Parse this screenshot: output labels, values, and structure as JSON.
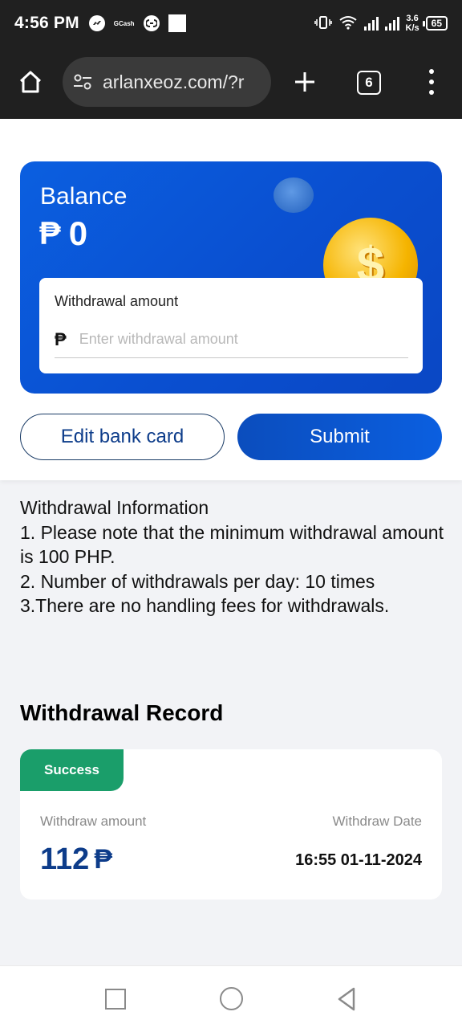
{
  "status_bar": {
    "time": "4:56 PM",
    "gcash_label": "GCash",
    "speed_top": "3.6",
    "speed_bottom": "K/s",
    "battery": "65"
  },
  "browser": {
    "url": "arlanxeoz.com/?r",
    "tab_count": "6"
  },
  "balance": {
    "label": "Balance",
    "currency_symbol": "₱",
    "amount": "0"
  },
  "withdraw_form": {
    "label": "Withdrawal amount",
    "currency_symbol": "₱",
    "placeholder": "Enter withdrawal amount",
    "value": ""
  },
  "buttons": {
    "edit_bank_card": "Edit bank card",
    "submit": "Submit"
  },
  "info": {
    "title": "Withdrawal Information",
    "lines": [
      "1. Please note that the minimum withdrawal amount is 100 PHP.",
      "2. Number of withdrawals per day: 10 times",
      "3.There are no handling fees for withdrawals."
    ]
  },
  "record": {
    "title": "Withdrawal Record",
    "items": [
      {
        "status": "Success",
        "amount_label": "Withdraw amount",
        "date_label": "Withdraw Date",
        "amount": "112",
        "currency_symbol": "₱",
        "date": "16:55 01-11-2024"
      }
    ]
  },
  "colors": {
    "accent": "#0b5fe0",
    "success": "#1a9e6a",
    "amount_text": "#0d3c8a"
  }
}
